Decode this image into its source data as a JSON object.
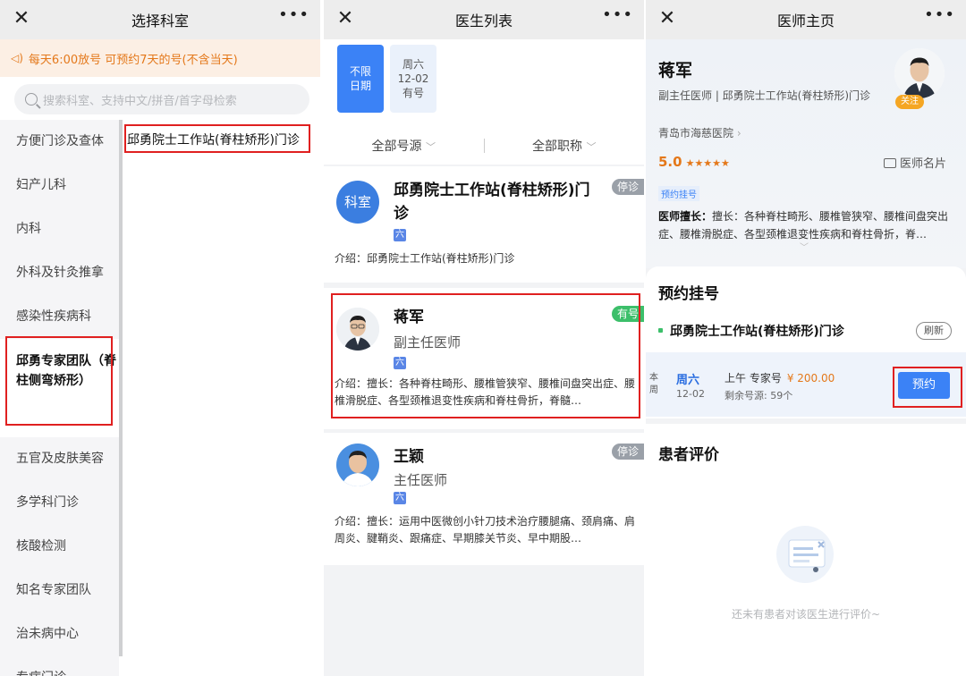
{
  "pane1": {
    "title": "选择科室",
    "notice": "每天6:00放号 可预约7天的号(不含当天)",
    "search_placeholder": "搜索科室、支持中文/拼音/首字母检索",
    "nav_items": [
      "方便门诊及查体",
      "妇产儿科",
      "内科",
      "外科及针灸推拿",
      "感染性疾病科",
      "邱勇专家团队（脊柱侧弯矫形）",
      "五官及皮肤美容",
      "多学科门诊",
      "核酸检测",
      "知名专家团队",
      "治未病中心",
      "专病门诊"
    ],
    "sub_item": "邱勇院士工作站(脊柱矫形)门诊"
  },
  "pane2": {
    "title": "医生列表",
    "date_all": [
      "不限",
      "日期"
    ],
    "date_sat": [
      "周六",
      "12-02",
      "有号"
    ],
    "filter_source": "全部号源",
    "filter_title": "全部职称",
    "cards": [
      {
        "avatar_text": "科室",
        "name": "邱勇院士工作站(脊柱矫形)门诊",
        "tag": "六",
        "intro": "介绍：邱勇院士工作站(脊柱矫形)门诊",
        "status": "停诊"
      },
      {
        "name": "蒋军",
        "title": "副主任医师",
        "tag": "六",
        "intro": "介绍：擅长：各种脊柱畸形、腰椎管狭窄、腰椎间盘突出症、腰椎滑脱症、各型颈椎退变性疾病和脊柱骨折，脊髓…",
        "status": "有号"
      },
      {
        "name": "王颖",
        "title": "主任医师",
        "tag": "六",
        "intro": "介绍：擅长：运用中医微创小针刀技术治疗腰腿痛、颈肩痛、肩周炎、腱鞘炎、跟痛症、早期膝关节炎、早中期股…",
        "status": "停诊"
      }
    ]
  },
  "pane3": {
    "title": "医师主页",
    "doctor_name": "蒋军",
    "doctor_title": "副主任医师 | 邱勇院士工作站(脊柱矫形)门诊",
    "hospital": "青岛市海慈医院",
    "rating": "5.0",
    "stars": "★★★★★",
    "card_link": "医师名片",
    "follow": "关注",
    "reg_tag": "预约挂号",
    "skill_label": "医师擅长：",
    "skill_text": "擅长：各种脊柱畸形、腰椎管狭窄、腰椎间盘突出症、腰椎滑脱症、各型颈椎退变性疾病和脊柱骨折，脊…",
    "booking_title": "预约挂号",
    "dept": "邱勇院士工作站(脊柱矫形)门诊",
    "refresh": "刷新",
    "week_mark": "本周",
    "slot_day": "周六",
    "slot_date": "12-02",
    "slot_kind": "上午 专家号",
    "slot_price": "¥ 200.00",
    "slot_left": "剩余号源: 59个",
    "book_btn": "预约",
    "reviews_title": "患者评价",
    "empty_text": "还未有患者对该医生进行评价~"
  },
  "colors": {
    "accent": "#3b82f6",
    "orange": "#e4781a",
    "green": "#3cbf6a",
    "red_box": "#e02020"
  }
}
